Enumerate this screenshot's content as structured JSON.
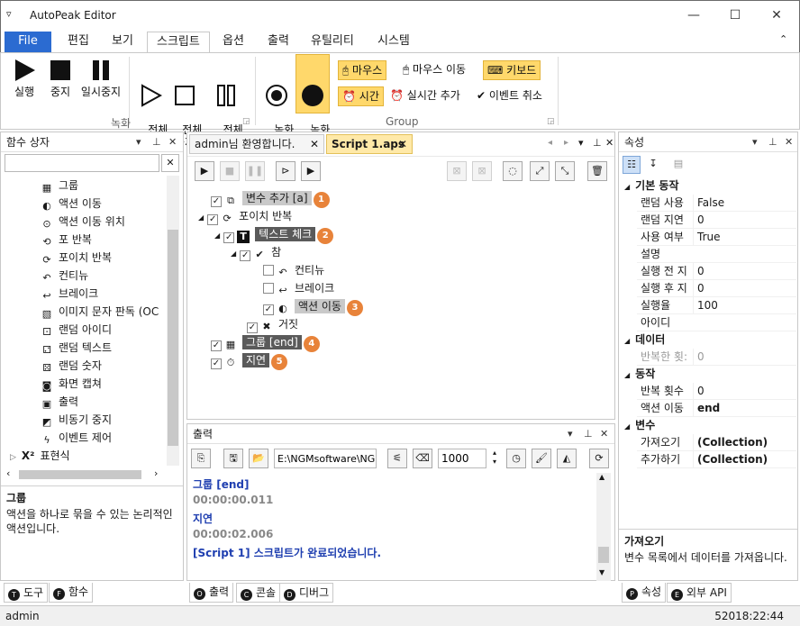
{
  "window": {
    "title": "AutoPeak Editor"
  },
  "menu": {
    "file": "File",
    "items": [
      "편집",
      "보기",
      "스크립트",
      "옵션",
      "출력",
      "유틸리티",
      "시스템"
    ]
  },
  "ribbon": {
    "play": "실행",
    "stop": "중지",
    "pause": "일시중지",
    "all_play": "전체\n실행",
    "all_stop": "전체\n중지",
    "all_pause": "전체\n일시중지",
    "group_record": "녹화",
    "rec_start": "녹화\n시작",
    "rec_stop": "녹화\n중지",
    "mouse": "마우스",
    "mouse_move": "마우스 이동",
    "keyboard": "키보드",
    "time": "시간",
    "realtime_add": "실시간 추가",
    "event_cancel": "이벤트 취소",
    "group_group": "Group"
  },
  "left_panel": {
    "title": "함수 상자",
    "items": [
      "그룹",
      "액션 이동",
      "액션 이동 위치",
      "포 반복",
      "포이치 반복",
      "컨티뉴",
      "브레이크",
      "이미지 문자 판독 (OC",
      "랜덤 아이디",
      "랜덤 텍스트",
      "랜덤 숫자",
      "화면 캡쳐",
      "출력",
      "비동기 중지",
      "이벤트 제어"
    ],
    "expr": "표현식",
    "desc_title": "그룹",
    "desc_text": "액션을 하나로 묶을 수 있는 논리적인 액션입니다.",
    "tabs": [
      "도구",
      "함수"
    ]
  },
  "editor": {
    "tabs": [
      "admin님 환영합니다.",
      "Script 1.aps"
    ],
    "nodes": {
      "var_add": "변수 추가 [a]",
      "foreach": "포이치 반복",
      "text_check": "텍스트 체크",
      "true": "참",
      "continue": "컨티뉴",
      "break": "브레이크",
      "action_move": "액션 이동",
      "false": "거짓",
      "group_end": "그룹 [end]",
      "delay": "지연"
    },
    "badges": [
      "1",
      "2",
      "3",
      "4",
      "5"
    ]
  },
  "output": {
    "title": "출력",
    "path": "E:\\NGMsoftware\\NG",
    "count": "1000",
    "lines": [
      {
        "text": "그룹 [end]",
        "kind": "blue"
      },
      {
        "text": "00:00:00.011",
        "kind": "gray"
      },
      {
        "text": "지연",
        "kind": "blue"
      },
      {
        "text": "00:00:02.006",
        "kind": "gray"
      },
      {
        "text": "[Script 1] 스크립트가 완료되었습니다.",
        "kind": "blue"
      }
    ],
    "tabs": [
      "출력",
      "콘솔",
      "디버그"
    ]
  },
  "properties": {
    "title": "속성",
    "sections": [
      {
        "name": "기본 동작",
        "rows": [
          [
            "랜덤 사용",
            "False"
          ],
          [
            "랜덤 지연",
            "0"
          ],
          [
            "사용 여부",
            "True"
          ],
          [
            "설명",
            ""
          ],
          [
            "실행 전 지",
            "0"
          ],
          [
            "실행 후 지",
            "0"
          ],
          [
            "실행율",
            "100"
          ],
          [
            "아이디",
            ""
          ]
        ]
      },
      {
        "name": "데이터",
        "rows": [
          [
            "반복한 횟:",
            "0"
          ]
        ]
      },
      {
        "name": "동작",
        "rows": [
          [
            "반복 횟수",
            "0"
          ],
          [
            "액션 이동",
            "end"
          ]
        ]
      },
      {
        "name": "변수",
        "rows": [
          [
            "가져오기",
            "(Collection)"
          ],
          [
            "추가하기",
            "(Collection)"
          ]
        ]
      }
    ],
    "desc_title": "가져오기",
    "desc_text": "변수 목록에서 데이터를 가져옵니다.",
    "tabs": [
      "속성",
      "외부 API"
    ]
  },
  "status": {
    "user": "admin",
    "time": "52018:22:44"
  },
  "colors": {
    "accent": "#2b6bd1",
    "badge": "#e8833a",
    "highlight": "#ffd86b",
    "output_blue": "#1f3fb0"
  }
}
